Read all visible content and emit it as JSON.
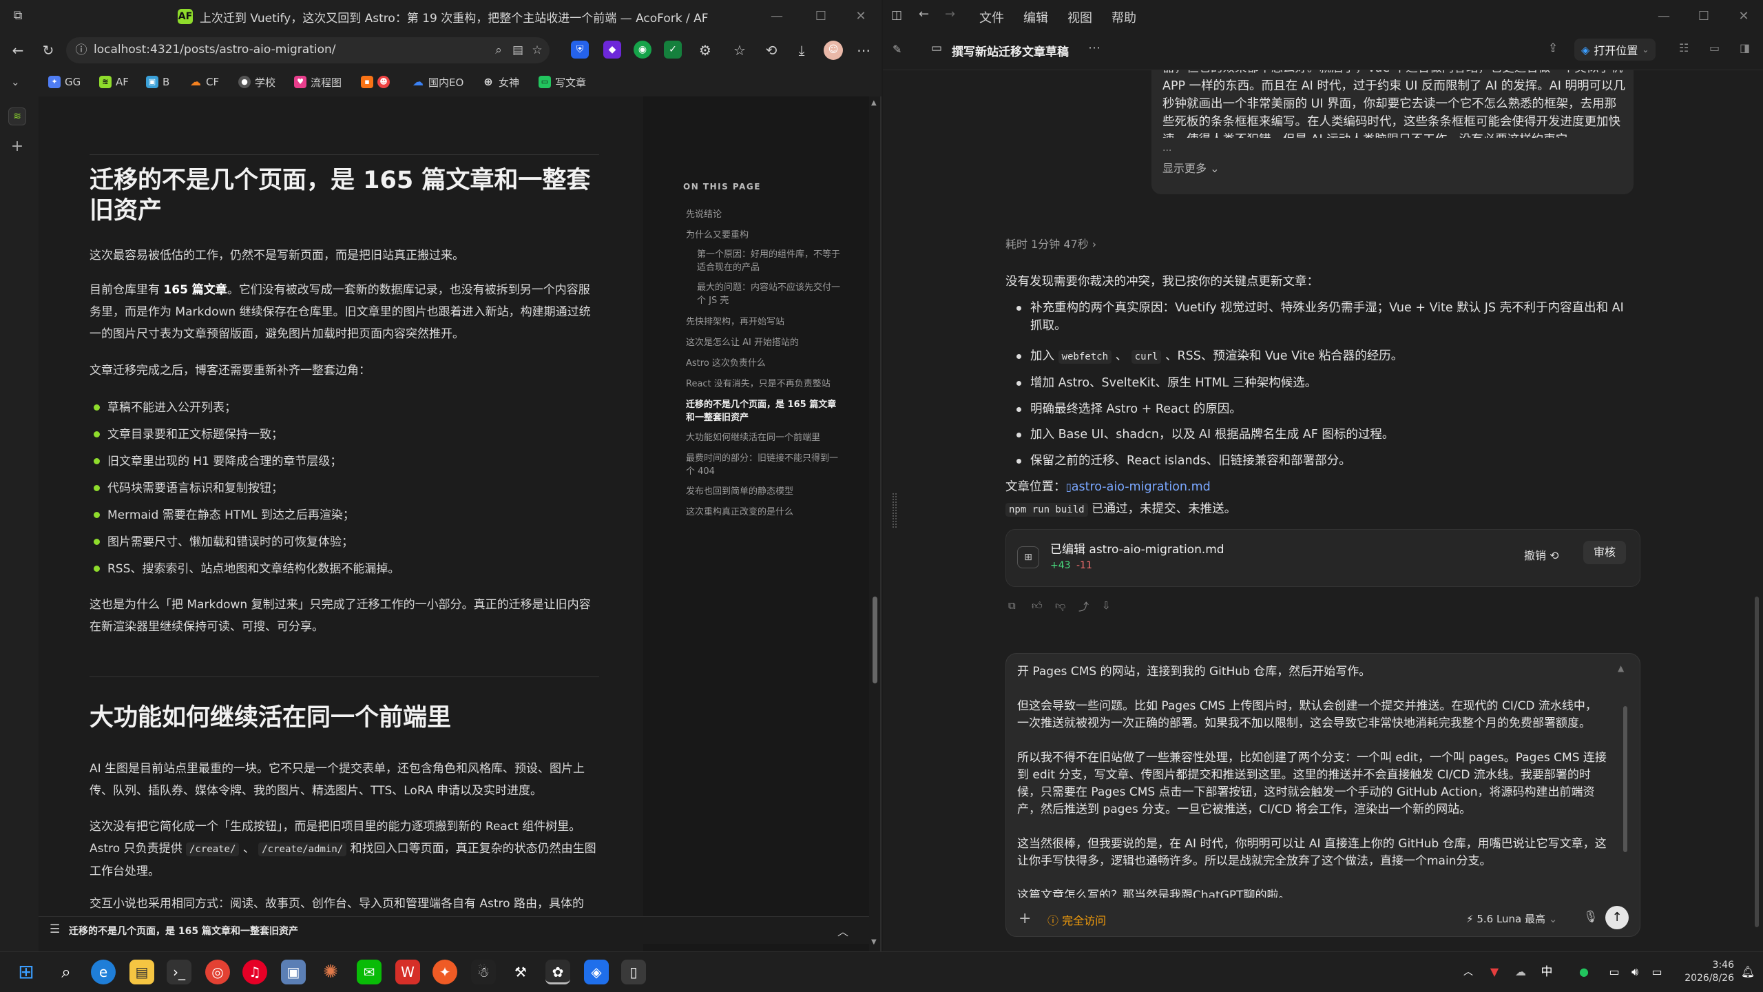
{
  "browser": {
    "window_title": "上次迁到 Vuetify，这次又回到 Astro：第 19 次重构，把整个主站收进一个前端 — AcoFork / AF",
    "favicon_text": "AF",
    "url": "localhost:4321/posts/astro-aio-migration/",
    "bookmarks": [
      "GG",
      "AF",
      "B",
      "CF",
      "学校",
      "流程图",
      "",
      "国内EO",
      "女神",
      "写文章"
    ],
    "bottom_bar_title": "迁移的不是几个页面，是 165 篇文章和一整套旧资产"
  },
  "article": {
    "h2_first": "迁移的不是几个页面，是 165 篇文章和一整套旧资产",
    "p1": "这次最容易被低估的工作，仍然不是写新页面，而是把旧站真正搬过来。",
    "p2_a": "目前仓库里有 ",
    "p2_bold": "165 篇文章",
    "p2_b": "。它们没有被改写成一套新的数据库记录，也没有被拆到另一个内容服务里，而是作为 Markdown 继续保存在仓库里。旧文章里的图片也跟着进入新站，构建期通过统一的图片尺寸表为文章预留版面，避免图片加载时把页面内容突然推开。",
    "p3": "文章迁移完成之后，博客还需要重新补齐一整套边角：",
    "list": [
      "草稿不能进入公开列表；",
      "文章目录要和正文标题保持一致；",
      "旧文章里出现的 H1 要降成合理的章节层级；",
      "代码块需要语言标识和复制按钮；",
      "Mermaid 需要在静态 HTML 到达之后再渲染；",
      "图片需要尺寸、懒加载和错误时的可恢复体验；",
      "RSS、搜索索引、站点地图和文章结构化数据不能漏掉。"
    ],
    "p4": "这也是为什么「把 Markdown 复制过来」只完成了迁移工作的一小部分。真正的迁移是让旧内容在新渲染器里继续保持可读、可搜、可分享。",
    "h2_second": "大功能如何继续活在同一个前端里",
    "p5": "AI 生图是目前站点里最重的一块。它不只是一个提交表单，还包含角色和风格库、预设、图片上传、队列、插队券、媒体令牌、我的图片、精选图片、TTS、LoRA 申请以及实时进度。",
    "p6_a": "这次没有把它简化成一个「生成按钮」，而是把旧项目里的能力逐项搬到新的 React 组件树里。Astro 只负责提供 ",
    "p6_code1": "/create/",
    "p6_sep": " 、 ",
    "p6_code2": "/create/admin/",
    "p6_b": " 和找回入口等页面，真正复杂的状态仍然由生图工作台处理。",
    "p7": "交互小说也采用相同方式：阅读、故事页、创作台、导入页和管理端各自有 Astro 路由，具体的"
  },
  "toc": {
    "heading": "ON THIS PAGE",
    "items": [
      {
        "label": "先说结论",
        "level": "top"
      },
      {
        "label": "为什么又要重构",
        "level": "top"
      },
      {
        "label": "第一个原因：好用的组件库，不等于适合现在的产品",
        "level": "sub"
      },
      {
        "label": "最大的问题：内容站不应该先交付一个 JS 壳",
        "level": "sub"
      },
      {
        "label": "先快排架构，再开始写站",
        "level": "top"
      },
      {
        "label": "这次是怎么让 AI 开始搭站的",
        "level": "top"
      },
      {
        "label": "Astro 这次负责什么",
        "level": "top"
      },
      {
        "label": "React 没有消失，只是不再负责整站",
        "level": "top"
      },
      {
        "label": "迁移的不是几个页面，是 165 篇文章和一整套旧资产",
        "level": "active"
      },
      {
        "label": "大功能如何继续活在同一个前端里",
        "level": "top"
      },
      {
        "label": "最费时间的部分：旧链接不能只得到一个 404",
        "level": "top"
      },
      {
        "label": "发布也回到简单的静态模型",
        "level": "top"
      },
      {
        "label": "这次重构真正改变的是什么",
        "level": "top"
      }
    ]
  },
  "chat": {
    "menu": [
      "文件",
      "编辑",
      "视图",
      "帮助"
    ],
    "thread_title": "撰写新站迁移文章草稿",
    "open_location": "打开位置",
    "user_prev_text": "器，但它的效果都不怎么好。就后了，Vue 不适合做内容站，它更适合做一个类似手机 APP 一样的东西。而且在 AI 时代，过于约束 UI 反而限制了 AI 的发挥。AI 明明可以几秒钟就画出一个非常美丽的 UI 界面，你却要它去读一个它不怎么熟悉的框架，去用那些死板的条条框框来编写。在人类编码时代，这些条条框框可能会使得开发进度更加快速，使得人类不犯错，但是 AI 运动人类脑限只不工作，没有必要这样约束它",
    "ellipsis": "...",
    "show_more": "显示更多",
    "elapsed": "耗时 1分钟 47秒",
    "reply_intro": "没有发现需要你裁决的冲突，我已按你的关键点更新文章：",
    "bullets": [
      {
        "text": "补充重构的两个真实原因：Vuetify 视觉过时、特殊业务仍需手湿；Vue + Vite 默认 JS 壳不利于内容直出和 AI 抓取。"
      },
      {
        "pre": "加入 ",
        "c1": "webfetch",
        "mid": " 、 ",
        "c2": "curl",
        "post": " 、RSS、预渲染和 Vue Vite 粘合器的经历。"
      },
      {
        "text": "增加 Astro、SvelteKit、原生 HTML 三种架构候选。"
      },
      {
        "text": "明确最终选择 Astro + React 的原因。"
      },
      {
        "text": "加入 Base UI、shadcn，以及 AI 根据品牌名生成 AF 图标的过程。"
      },
      {
        "text": "保留之前的迁移、React islands、旧链接兼容和部署部分。"
      }
    ],
    "file_label": "文章位置：",
    "file_name": "astro-aio-migration.md",
    "build_code": "npm run build",
    "build_status": " 已通过，未提交、未推送。",
    "edit_card": {
      "title": "已编辑 astro-aio-migration.md",
      "added": "+43",
      "removed": "-11",
      "undo": "撤销",
      "review": "审核"
    },
    "composer_paragraphs": [
      "开 Pages CMS 的网站，连接到我的 GitHub 仓库，然后开始写作。",
      "但这会导致一些问题。比如 Pages CMS 上传图片时，默认会创建一个提交并推送。在现代的 CI/CD 流水线中，一次推送就被视为一次正确的部署。如果我不加以限制，这会导致它非常快地消耗完我整个月的免费部署额度。",
      "所以我不得不在旧站做了一些兼容性处理，比如创建了两个分支：一个叫 edit，一个叫 pages。Pages CMS 连接到 edit 分支，写文章、传图片都提交和推送到这里。这里的推送并不会直接触发 CI/CD 流水线。我要部署的时候，只需要在 Pages CMS 点击一下部署按钮，这时就会触发一个手动的 GitHub Action，将源码构建出前端资产，然后推送到 pages 分支。一旦它被推送，CI/CD 将会工作，渲染出一个新的网站。",
      "这当然很棒，但我要说的是，在 AI 时代，你明明可以让 AI 直接连上你的 GitHub 仓库，用嘴巴说让它写文章，这让你手写快得多，逻辑也通畅许多。所以是战就完全放弃了这个做法，直接一个main分支。",
      "这篇文章怎么写的？那当然是我跟ChatGPT聊的啦。"
    ],
    "access_label": "完全访问",
    "model_label": "5.6 Luna 最高"
  },
  "taskbar": {
    "time": "3:46",
    "date": "2026/8/26",
    "ime": "中"
  }
}
